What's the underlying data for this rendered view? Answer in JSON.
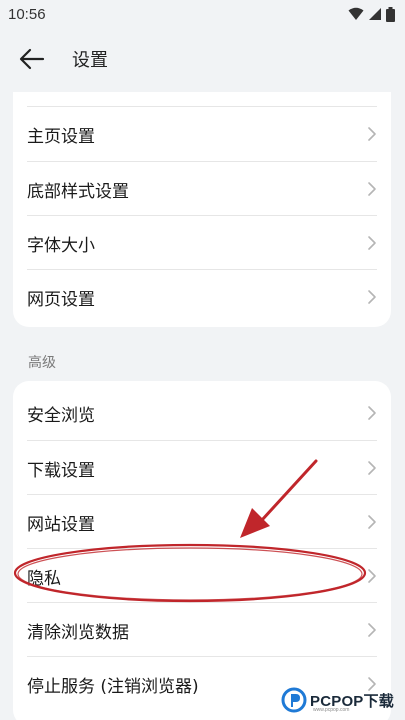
{
  "status_bar": {
    "time": "10:56"
  },
  "app_bar": {
    "title": "设置"
  },
  "card1": {
    "items": [
      {
        "label": "主页设置"
      },
      {
        "label": "底部样式设置"
      },
      {
        "label": "字体大小"
      },
      {
        "label": "网页设置"
      }
    ]
  },
  "section_advanced": {
    "label": "高级"
  },
  "card2": {
    "items": [
      {
        "label": "安全浏览"
      },
      {
        "label": "下载设置"
      },
      {
        "label": "网站设置"
      },
      {
        "label": "隐私"
      },
      {
        "label": "清除浏览数据"
      },
      {
        "label": "停止服务 (注销浏览器)"
      }
    ]
  },
  "watermark": {
    "brand": "PCPOP下载",
    "subtitle": "www.pcpop.com"
  },
  "colors": {
    "annotation": "#c0262b",
    "background": "#f1f3f5",
    "card": "#ffffff"
  },
  "icons": {
    "back": "arrow-left-icon",
    "chevron": "chevron-right-icon",
    "wifi": "wifi-icon",
    "signal": "signal-icon",
    "battery": "battery-icon"
  }
}
